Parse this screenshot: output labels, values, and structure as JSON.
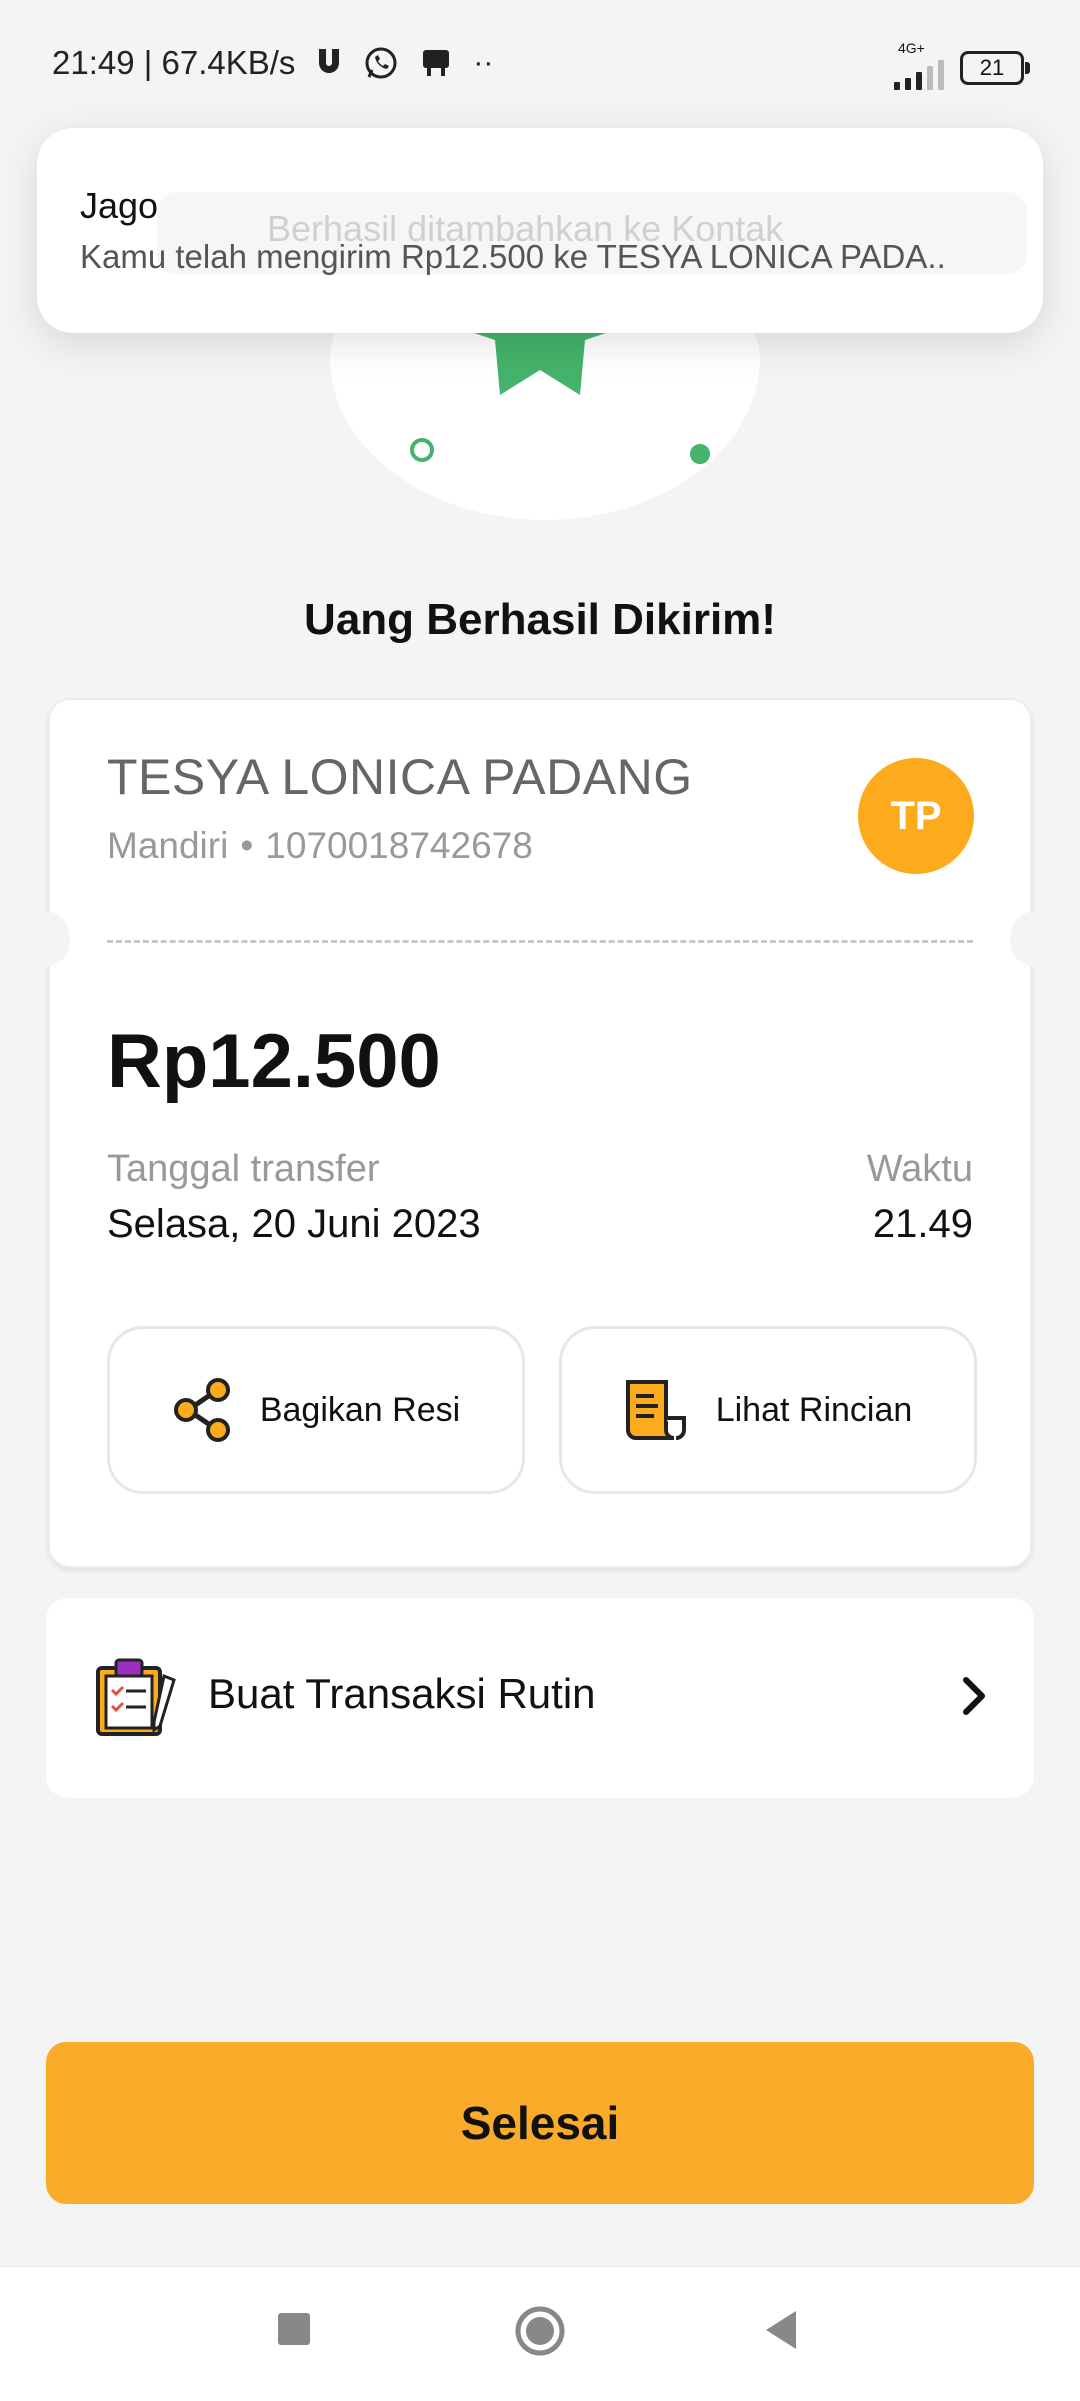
{
  "status_bar": {
    "time_speed": "21:49 | 67.4KB/s",
    "network": "4G+",
    "battery": "21",
    "more_indicator": "··"
  },
  "notification": {
    "app_name": "Jago",
    "message": "Kamu telah mengirim Rp12.500 ke TESYA LONICA PADA..",
    "behind_toast_text": "Berhasil ditambahkan ke Kontak"
  },
  "headline": "Uang Berhasil Dikirim!",
  "receipt": {
    "recipient_name": "TESYA LONICA PADANG",
    "bank": "Mandiri",
    "separator": "•",
    "account_number": "1070018742678",
    "avatar_initials": "TP",
    "amount": "Rp12.500",
    "date_label": "Tanggal transfer",
    "date_value": "Selasa, 20 Juni 2023",
    "time_label": "Waktu",
    "time_value": "21.49",
    "share_button": "Bagikan Resi",
    "details_button": "Lihat Rincian"
  },
  "routine": {
    "label": "Buat Transaksi Rutin"
  },
  "done_button": "Selesai",
  "colors": {
    "accent": "#fbab2a",
    "success_green": "#45b36b",
    "avatar_bg": "#fbab1c"
  }
}
